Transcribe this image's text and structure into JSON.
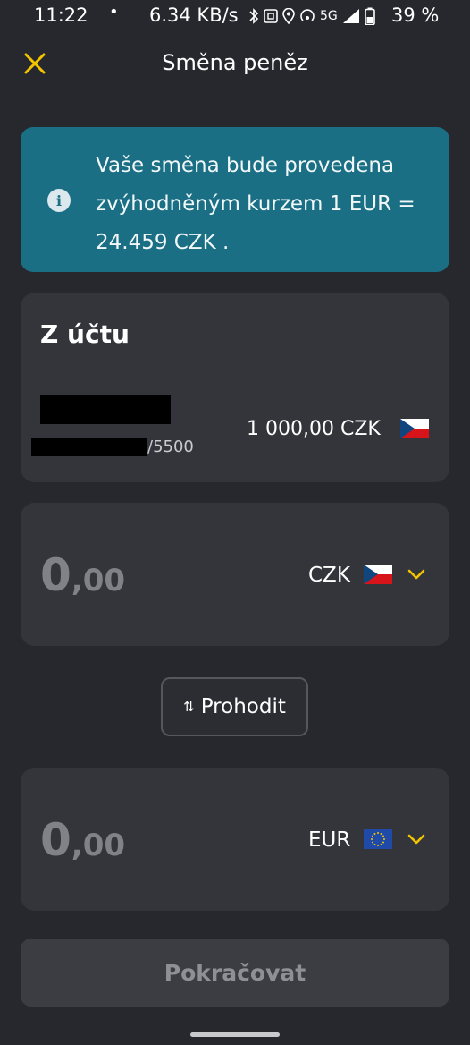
{
  "status_bar": {
    "time": "11:22",
    "dot": "•",
    "speed": "6.34 KB/s",
    "network": "5G",
    "battery": "39 %"
  },
  "header": {
    "title": "Směna peněz"
  },
  "banner": {
    "text": "Vaše směna bude provedena zvýhodněným kurzem 1 EUR = 24.459 CZK ."
  },
  "from_account": {
    "title": "Z účtu",
    "account_suffix": "/5500",
    "balance": "1 000,00 CZK"
  },
  "from_amount": {
    "integer": "0",
    "decimal": ",00",
    "currency": "CZK"
  },
  "swap": {
    "label": "Prohodit",
    "icon": "⇅"
  },
  "to_amount": {
    "integer": "0",
    "decimal": ",00",
    "currency": "EUR"
  },
  "continue": {
    "label": "Pokračovat"
  },
  "colors": {
    "background": "#26282d",
    "card": "#33353b",
    "banner": "#1a6f84",
    "accent": "#f2c500",
    "muted_amount": "#808287"
  }
}
